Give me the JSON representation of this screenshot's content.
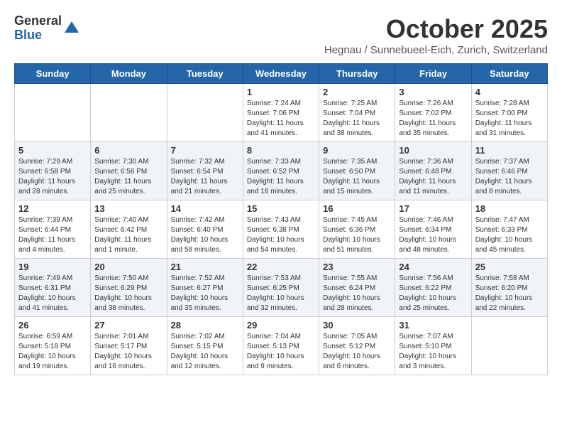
{
  "header": {
    "logo_general": "General",
    "logo_blue": "Blue",
    "month_title": "October 2025",
    "subtitle": "Hegnau / Sunnebueel-Eich, Zurich, Switzerland"
  },
  "days_of_week": [
    "Sunday",
    "Monday",
    "Tuesday",
    "Wednesday",
    "Thursday",
    "Friday",
    "Saturday"
  ],
  "weeks": [
    [
      {
        "day": "",
        "info": ""
      },
      {
        "day": "",
        "info": ""
      },
      {
        "day": "",
        "info": ""
      },
      {
        "day": "1",
        "info": "Sunrise: 7:24 AM\nSunset: 7:06 PM\nDaylight: 11 hours and 41 minutes."
      },
      {
        "day": "2",
        "info": "Sunrise: 7:25 AM\nSunset: 7:04 PM\nDaylight: 11 hours and 38 minutes."
      },
      {
        "day": "3",
        "info": "Sunrise: 7:26 AM\nSunset: 7:02 PM\nDaylight: 11 hours and 35 minutes."
      },
      {
        "day": "4",
        "info": "Sunrise: 7:28 AM\nSunset: 7:00 PM\nDaylight: 11 hours and 31 minutes."
      }
    ],
    [
      {
        "day": "5",
        "info": "Sunrise: 7:29 AM\nSunset: 6:58 PM\nDaylight: 11 hours and 28 minutes."
      },
      {
        "day": "6",
        "info": "Sunrise: 7:30 AM\nSunset: 6:56 PM\nDaylight: 11 hours and 25 minutes."
      },
      {
        "day": "7",
        "info": "Sunrise: 7:32 AM\nSunset: 6:54 PM\nDaylight: 11 hours and 21 minutes."
      },
      {
        "day": "8",
        "info": "Sunrise: 7:33 AM\nSunset: 6:52 PM\nDaylight: 11 hours and 18 minutes."
      },
      {
        "day": "9",
        "info": "Sunrise: 7:35 AM\nSunset: 6:50 PM\nDaylight: 11 hours and 15 minutes."
      },
      {
        "day": "10",
        "info": "Sunrise: 7:36 AM\nSunset: 6:48 PM\nDaylight: 11 hours and 11 minutes."
      },
      {
        "day": "11",
        "info": "Sunrise: 7:37 AM\nSunset: 6:46 PM\nDaylight: 11 hours and 8 minutes."
      }
    ],
    [
      {
        "day": "12",
        "info": "Sunrise: 7:39 AM\nSunset: 6:44 PM\nDaylight: 11 hours and 4 minutes."
      },
      {
        "day": "13",
        "info": "Sunrise: 7:40 AM\nSunset: 6:42 PM\nDaylight: 11 hours and 1 minute."
      },
      {
        "day": "14",
        "info": "Sunrise: 7:42 AM\nSunset: 6:40 PM\nDaylight: 10 hours and 58 minutes."
      },
      {
        "day": "15",
        "info": "Sunrise: 7:43 AM\nSunset: 6:38 PM\nDaylight: 10 hours and 54 minutes."
      },
      {
        "day": "16",
        "info": "Sunrise: 7:45 AM\nSunset: 6:36 PM\nDaylight: 10 hours and 51 minutes."
      },
      {
        "day": "17",
        "info": "Sunrise: 7:46 AM\nSunset: 6:34 PM\nDaylight: 10 hours and 48 minutes."
      },
      {
        "day": "18",
        "info": "Sunrise: 7:47 AM\nSunset: 6:33 PM\nDaylight: 10 hours and 45 minutes."
      }
    ],
    [
      {
        "day": "19",
        "info": "Sunrise: 7:49 AM\nSunset: 6:31 PM\nDaylight: 10 hours and 41 minutes."
      },
      {
        "day": "20",
        "info": "Sunrise: 7:50 AM\nSunset: 6:29 PM\nDaylight: 10 hours and 38 minutes."
      },
      {
        "day": "21",
        "info": "Sunrise: 7:52 AM\nSunset: 6:27 PM\nDaylight: 10 hours and 35 minutes."
      },
      {
        "day": "22",
        "info": "Sunrise: 7:53 AM\nSunset: 6:25 PM\nDaylight: 10 hours and 32 minutes."
      },
      {
        "day": "23",
        "info": "Sunrise: 7:55 AM\nSunset: 6:24 PM\nDaylight: 10 hours and 28 minutes."
      },
      {
        "day": "24",
        "info": "Sunrise: 7:56 AM\nSunset: 6:22 PM\nDaylight: 10 hours and 25 minutes."
      },
      {
        "day": "25",
        "info": "Sunrise: 7:58 AM\nSunset: 6:20 PM\nDaylight: 10 hours and 22 minutes."
      }
    ],
    [
      {
        "day": "26",
        "info": "Sunrise: 6:59 AM\nSunset: 5:18 PM\nDaylight: 10 hours and 19 minutes."
      },
      {
        "day": "27",
        "info": "Sunrise: 7:01 AM\nSunset: 5:17 PM\nDaylight: 10 hours and 16 minutes."
      },
      {
        "day": "28",
        "info": "Sunrise: 7:02 AM\nSunset: 5:15 PM\nDaylight: 10 hours and 12 minutes."
      },
      {
        "day": "29",
        "info": "Sunrise: 7:04 AM\nSunset: 5:13 PM\nDaylight: 10 hours and 9 minutes."
      },
      {
        "day": "30",
        "info": "Sunrise: 7:05 AM\nSunset: 5:12 PM\nDaylight: 10 hours and 6 minutes."
      },
      {
        "day": "31",
        "info": "Sunrise: 7:07 AM\nSunset: 5:10 PM\nDaylight: 10 hours and 3 minutes."
      },
      {
        "day": "",
        "info": ""
      }
    ]
  ]
}
